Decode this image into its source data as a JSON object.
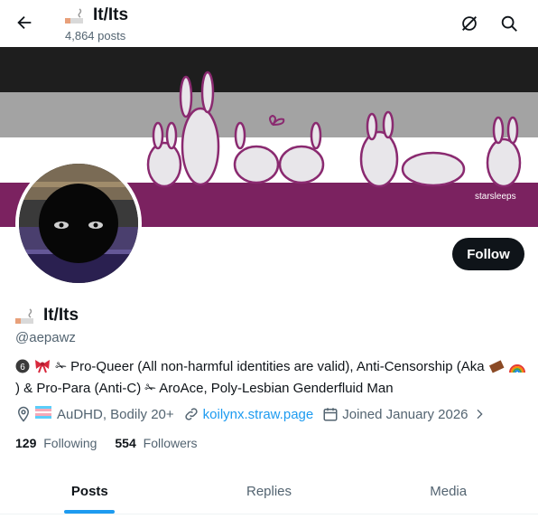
{
  "header": {
    "title": "It/Its",
    "posts_count": "4,864 posts",
    "back_icon": "arrow-left-icon",
    "icons": [
      "no-notifications-icon",
      "search-icon"
    ]
  },
  "banner": {
    "colors": [
      "#1e1e1e",
      "#a3a3a3",
      "#ffffff",
      "#7b2260"
    ],
    "signature": "starsleeps"
  },
  "profile": {
    "name": "It/Its",
    "handle": "@aepawz",
    "follow_label": "Follow",
    "bio_prefix": "6",
    "bio_text": "✁ Pro-Queer (All non-harmful identities are valid), Anti-Censorship (Aka",
    "bio_text2": ") & Pro-Para (Anti-C) ✁ AroAce, Poly-Lesbian Genderfluid Man",
    "location": "AuDHD, Bodily 20+",
    "website": "koilynx.straw.page",
    "joined": "Joined January 2026",
    "following_count": "129",
    "following_label": "Following",
    "followers_count": "554",
    "followers_label": "Followers"
  },
  "tabs": [
    {
      "label": "Posts",
      "active": true
    },
    {
      "label": "Replies",
      "active": false
    },
    {
      "label": "Media",
      "active": false
    }
  ],
  "colors": {
    "accent": "#1d9bf0",
    "text": "#0f1419",
    "secondary": "#536471"
  }
}
